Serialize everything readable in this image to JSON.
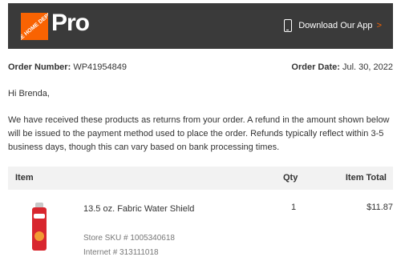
{
  "header": {
    "logo_text": "THE HOME DEPOT",
    "pro_label": "Pro",
    "app_link_label": "Download Our App",
    "app_link_chevron": ">",
    "brand_color": "#f96302",
    "bar_color": "#3a3a3a"
  },
  "order": {
    "number_label": "Order Number:",
    "number_value": "WP41954849",
    "date_label": "Order Date:",
    "date_value": "Jul. 30, 2022"
  },
  "greeting": "Hi Brenda,",
  "message": "We have received these products as returns from your order. A refund in the amount shown below will be issued to the payment method used to place the order. Refunds typically reflect within 3-5 business days, though this can vary based on bank processing times.",
  "table": {
    "headers": {
      "item": "Item",
      "qty": "Qty",
      "total": "Item Total"
    },
    "rows": [
      {
        "image_icon": "spray-can-icon",
        "name": "13.5 oz. Fabric Water Shield",
        "qty": "1",
        "total": "$11.87",
        "sku": "Store SKU # 1005340618",
        "internet": "Internet # 313111018"
      }
    ]
  }
}
